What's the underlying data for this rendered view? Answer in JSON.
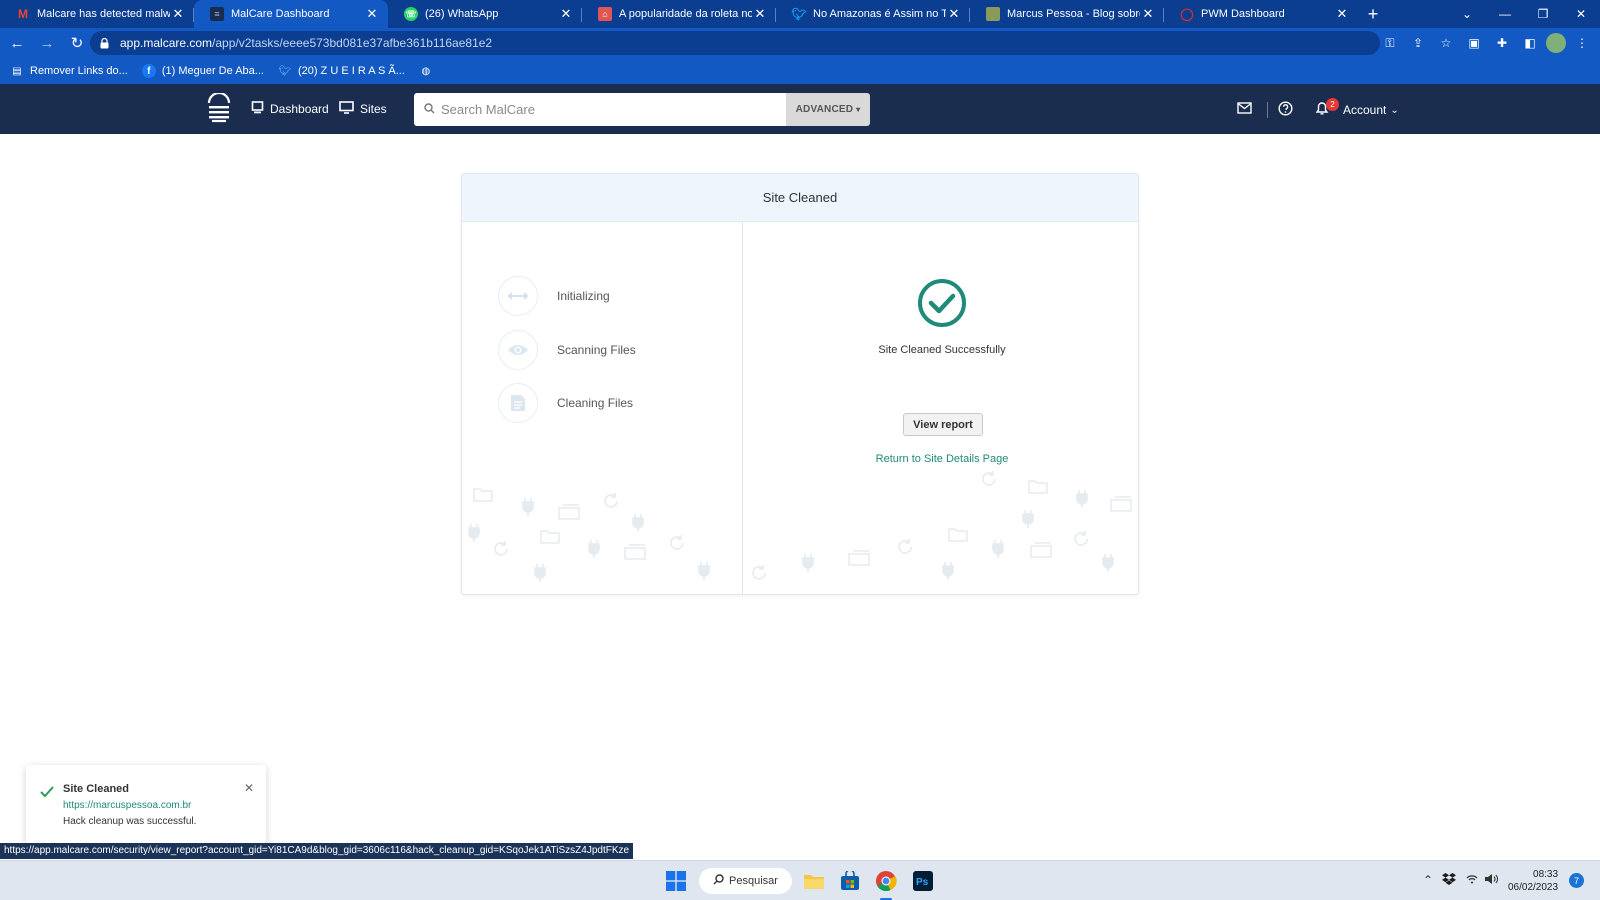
{
  "browser": {
    "tabs": [
      {
        "title": "Malcare has detected malware o",
        "favicon": "gmail-icon",
        "color": "#ea4335",
        "active": false
      },
      {
        "title": "MalCare Dashboard",
        "favicon": "malcare-icon",
        "color": "#1b2d4f",
        "active": true
      },
      {
        "title": "(26) WhatsApp",
        "favicon": "whatsapp-icon",
        "color": "#25d366",
        "active": false
      },
      {
        "title": "A popularidade da roleta no Bra",
        "favicon": "site-icon",
        "color": "#e25555",
        "active": false
      },
      {
        "title": "No Amazonas é Assim no Twitte",
        "favicon": "twitter-icon",
        "color": "#1d9bf0",
        "active": false
      },
      {
        "title": "Marcus Pessoa - Blog sobre a A",
        "favicon": "blog-icon",
        "color": "#8a9a5b",
        "active": false
      },
      {
        "title": "PWM Dashboard",
        "favicon": "pwm-icon",
        "color": "#d32f2f",
        "active": false
      }
    ],
    "url_host": "app.malcare.com",
    "url_path": "/app/v2tasks/eeee573bd081e37afbe361b116ae81e2",
    "bookmarks": [
      {
        "label": "Remover Links do...",
        "icon": "bookmark-site-icon"
      },
      {
        "label": "(1) Meguer De Aba...",
        "icon": "facebook-icon"
      },
      {
        "label": "(20) Z U E I R A S Ã...",
        "icon": "twitter-icon"
      },
      {
        "label": "",
        "icon": "globe-icon"
      }
    ]
  },
  "header": {
    "nav": [
      {
        "label": "Dashboard",
        "icon": "dashboard-icon"
      },
      {
        "label": "Sites",
        "icon": "monitor-icon"
      }
    ],
    "search_placeholder": "Search MalCare",
    "advanced_label": "ADVANCED",
    "notification_count": "2",
    "account_label": "Account"
  },
  "card": {
    "title": "Site Cleaned",
    "steps": [
      {
        "label": "Initializing",
        "icon": "arrows-icon"
      },
      {
        "label": "Scanning Files",
        "icon": "eye-icon"
      },
      {
        "label": "Cleaning Files",
        "icon": "file-icon"
      }
    ],
    "success_message": "Site Cleaned Successfully",
    "view_report_label": "View report",
    "return_link_label": "Return to Site Details Page",
    "accent_color": "#1f8a7a"
  },
  "toast": {
    "title": "Site Cleaned",
    "url": "https://marcuspessoa.com.br",
    "description": "Hack cleanup was successful."
  },
  "status_bar_url": "https://app.malcare.com/security/view_report?account_gid=Yi81CA9d&blog_gid=3606c116&hack_cleanup_gid=KSqoJek1ATiSzsZ4JpdtFKze",
  "taskbar": {
    "search_label": "Pesquisar",
    "time": "08:33",
    "date": "06/02/2023",
    "notification_count": "7"
  }
}
